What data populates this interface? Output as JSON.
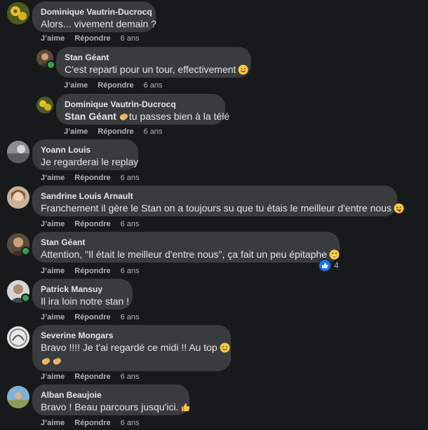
{
  "actions": {
    "like": "J’aime",
    "reply": "Répondre"
  },
  "comments": [
    {
      "author": "Dominique Vautrin-Ducrocq",
      "text": "Alors... vivement demain ?",
      "time": "6 ans"
    },
    {
      "author": "Stan Géant",
      "text": "C'est reparti pour un tour, effectivement",
      "emoji": "smile-emoji",
      "time": "6 ans"
    },
    {
      "author": "Dominique Vautrin-Ducrocq",
      "mention": "Stan Géant",
      "text": "tu passes bien à la télé",
      "emoji": "clap-emoji",
      "time": "6 ans"
    },
    {
      "author": "Yoann Louis",
      "text": "Je regarderai le replay",
      "time": "6 ans"
    },
    {
      "author": "Sandrine Louis Arnault",
      "text": "Franchement il gère le Stan on a toujours su que tu étais le meilleur d'entre nous",
      "emoji": "tongue-wink-emoji",
      "time": "6 ans"
    },
    {
      "author": "Stan Géant",
      "text": "Attention, \"Il était le meilleur d'entre nous\", ça fait un peu épitaphe",
      "emoji": "grin-emoji",
      "time": "6 ans",
      "reaction_count": "4",
      "reaction_icon": "thumbs-up-icon"
    },
    {
      "author": "Patrick Mansuy",
      "text": "Il ira loin notre stan !",
      "time": "6 ans"
    },
    {
      "author": "Severine Mongars",
      "text": "Bravo !!!! Je t'ai regardé ce midi !! Au top",
      "emoji": "wink-emoji",
      "line2_emoji": "clap-emoji",
      "time": "6 ans"
    },
    {
      "author": "Alban Beaujoie",
      "text": "Bravo ! Beau parcours jusqu'ici.",
      "emoji": "thumbs-up-emoji",
      "time": "6 ans"
    }
  ]
}
